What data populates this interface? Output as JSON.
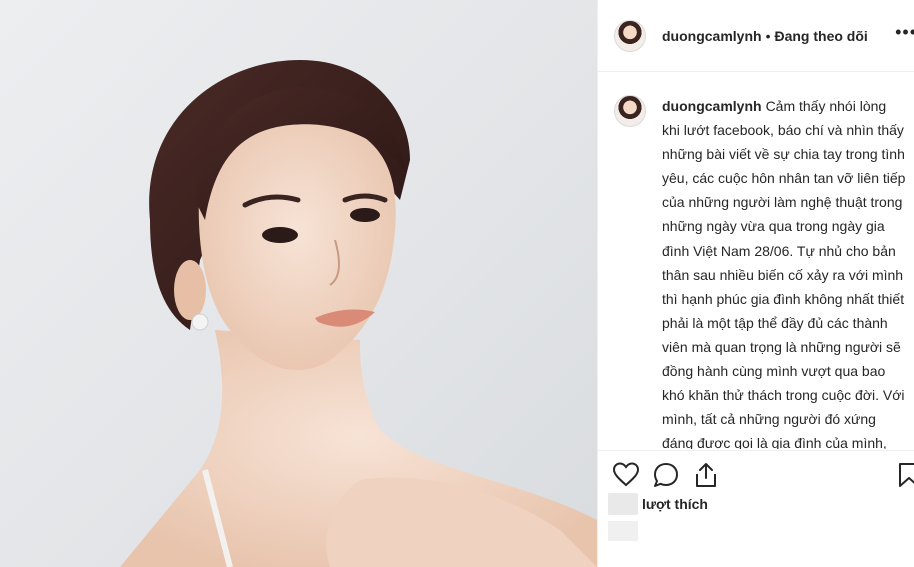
{
  "post": {
    "username": "duongcamlynh",
    "separator": "•",
    "follow_status": "Đang theo dõi",
    "more_label": "•••",
    "caption_user": "duongcamlynh",
    "caption_text": "Cảm thấy nhói lòng khi lướt facebook, báo chí và nhìn thấy những bài viết về sự chia tay trong tình yêu, các cuộc hôn nhân tan vỡ liên tiếp của những người làm nghệ thuật trong những ngày vừa qua trong ngày gia đình Việt Nam 28/06. Tự nhủ cho bản thân sau nhiều biến cố xảy ra với mình thì hạnh phúc gia đình không nhất thiết phải là một tập thể đầy đủ các thành viên mà quan trọng là những người sẽ đồng hành cùng mình vượt qua bao khó khăn thử thách trong cuộc đời. Với mình, tất cả những người đó xứng đáng được gọi là gia đình của mình, mình thích cái hạnh phúc thật trân trọng từng ngày tháng mình sống hơn là sống phải che đậy một điều gì đó mà phải luôn bao bọc gọi đó là gia đình. Gia đình là những gì",
    "likes_label": "lượt thích"
  },
  "icons": {
    "like": "heart-icon",
    "comment": "comment-icon",
    "share": "share-icon",
    "save": "bookmark-icon"
  }
}
